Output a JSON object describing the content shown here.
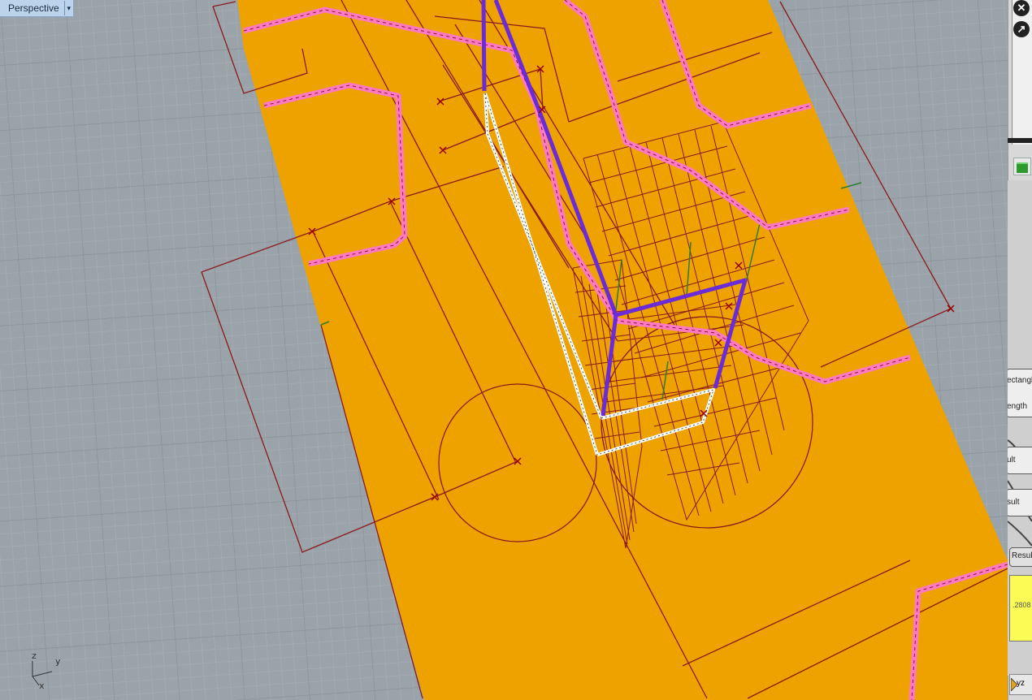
{
  "viewport": {
    "title": "Perspective",
    "dropdown_icon": "triangle-down",
    "axes": {
      "z": "z",
      "y": "y",
      "x": "x"
    }
  },
  "colors": {
    "background": "#9aa2aa",
    "grid_minor": "#a7aeb5",
    "grid_major": "#8b939a",
    "surface": "#eda200",
    "curves_pink": "#ff79c2",
    "curves_darkred": "#8b0000",
    "highlight_purple": "#6b2bd9",
    "highlight_white": "#ffffff"
  },
  "grasshopper": {
    "labels": [
      "ectangl",
      "ength",
      "ult",
      "sult",
      "Result"
    ],
    "panel_value": ".2808",
    "bottom_label": "yz"
  }
}
